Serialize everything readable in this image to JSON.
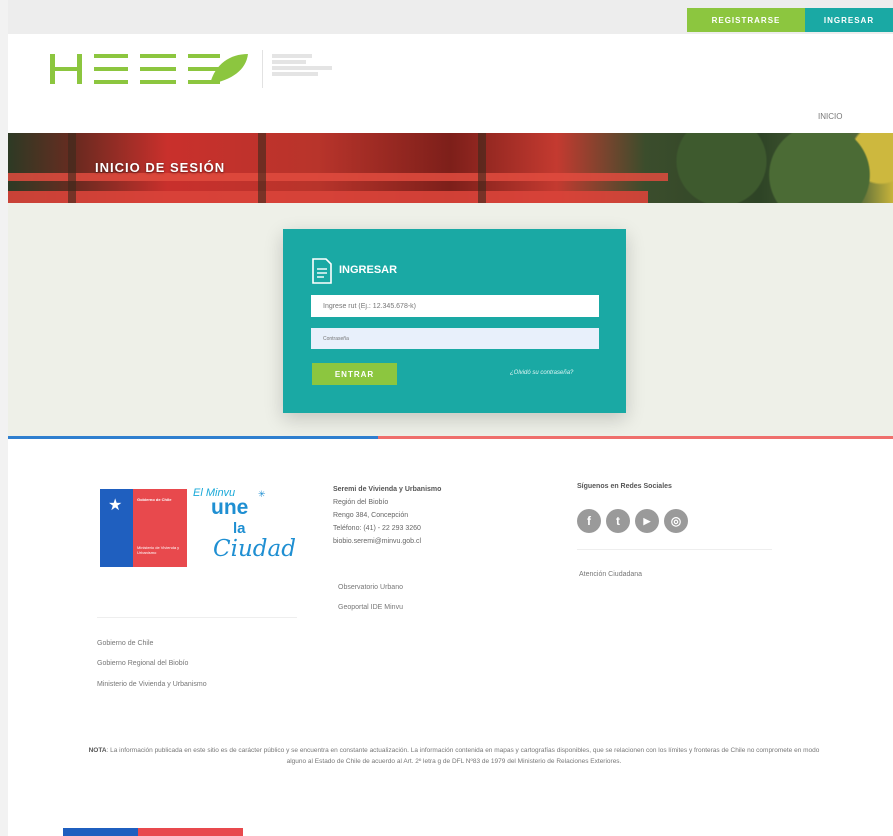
{
  "topbar": {
    "registrarse_label": "REGISTRARSE",
    "ingresar_label": "INGRESAR"
  },
  "brand": {
    "logo_text": "HESE",
    "colors": {
      "green": "#8cc63f",
      "teal": "#1aa9a4",
      "blue": "#2f7fcf",
      "red": "#ef6f6c"
    }
  },
  "nav": {
    "inicio_label": "INICIO"
  },
  "banner": {
    "title": "INICIO DE SESIÓN"
  },
  "login": {
    "icon": "document-icon",
    "title": "INGRESAR",
    "rut_placeholder": "Ingrese rut (Ej.: 12.345.678-k)",
    "clave_placeholder": "Contraseña",
    "submit_label": "ENTRAR",
    "forgot_label": "¿Olvidó su contraseña?"
  },
  "footer": {
    "gob_logo": {
      "top_text": "Gobierno de Chile",
      "bottom_text": "Ministerio de Vivienda y Urbanismo"
    },
    "campaign_logo": {
      "line1": "El Minvu",
      "line2": "une",
      "line3": "la",
      "line4": "Ciudad"
    },
    "contact": {
      "org": "Seremi de Vivienda y Urbanismo",
      "region": "Región del Biobío",
      "address": "Rengo 384, Concepción",
      "phone": "Teléfono: (41) - 22 293 3260",
      "email": "biobio.seremi@minvu.gob.cl"
    },
    "middle_links": [
      "Observatorio Urbano",
      "Geoportal IDE Minvu"
    ],
    "left_links": [
      "Gobierno de Chile",
      "Gobierno Regional del Biobío",
      "Ministerio de Vivienda y Urbanismo"
    ],
    "social": {
      "title": "Síguenos en Redes Sociales",
      "icons": [
        "facebook-icon",
        "twitter-icon",
        "youtube-icon",
        "instagram-icon"
      ],
      "glyphs": [
        "f",
        "t",
        "▶",
        "◎"
      ]
    },
    "atencion_link": "Atención Ciudadana",
    "nota_label": "NOTA",
    "nota_text": ": La información publicada en este sitio es de carácter público y se encuentra en constante actualización. La información contenida en mapas y cartografías disponibles, que se relacionen con los límites y fronteras de Chile no compromete en modo alguno al Estado de Chile de acuerdo al Art. 2º letra g de DFL Nº83 de 1979 del Ministerio de Relaciones Exteriores."
  }
}
